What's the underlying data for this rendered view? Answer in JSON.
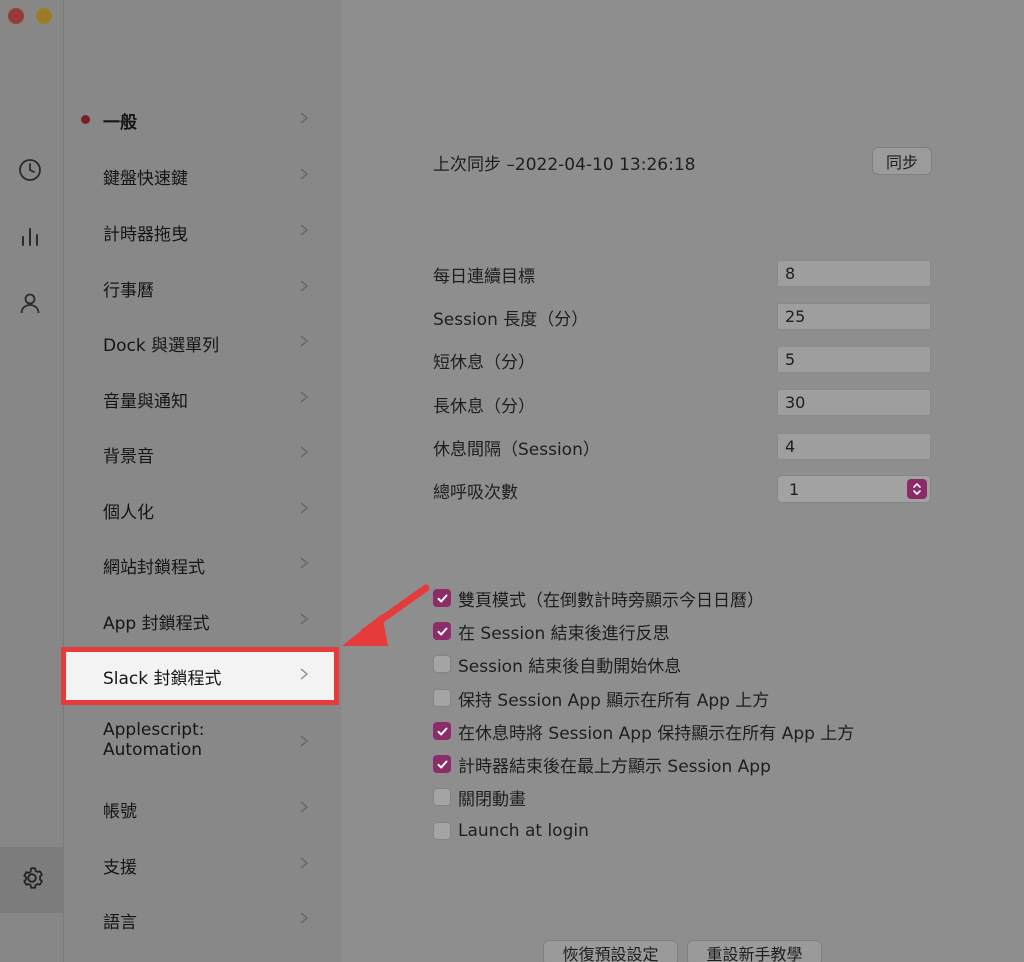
{
  "nav": {
    "items": [
      {
        "label": "一般"
      },
      {
        "label": "鍵盤快速鍵"
      },
      {
        "label": "計時器拖曳"
      },
      {
        "label": "行事曆"
      },
      {
        "label": "Dock 與選單列"
      },
      {
        "label": "音量與通知"
      },
      {
        "label": "背景音"
      },
      {
        "label": "個人化"
      },
      {
        "label": "網站封鎖程式"
      },
      {
        "label": "App 封鎖程式"
      },
      {
        "label": "Slack 封鎖程式"
      },
      {
        "label": "Applescript:",
        "label2": "Automation"
      },
      {
        "label": "帳號"
      },
      {
        "label": "支援"
      },
      {
        "label": "語言"
      }
    ]
  },
  "sync": {
    "text": "上次同步 –2022-04-10 13:26:18",
    "button": "同步"
  },
  "form": {
    "daily_goal": {
      "label": "每日連續目標",
      "value": "8"
    },
    "session_length": {
      "label": "Session 長度（分）",
      "value": "25"
    },
    "short_break": {
      "label": "短休息（分）",
      "value": "5"
    },
    "long_break": {
      "label": "長休息（分）",
      "value": "30"
    },
    "break_interval": {
      "label": "休息間隔（Session）",
      "value": "4"
    },
    "breaths": {
      "label": "總呼吸次數",
      "value": "1"
    }
  },
  "options": [
    {
      "label": "雙頁模式（在倒數計時旁顯示今日日曆）",
      "checked": true
    },
    {
      "label": "在 Session 結束後進行反思",
      "checked": true
    },
    {
      "label": "Session 結束後自動開始休息",
      "checked": false
    },
    {
      "label": "保持 Session App 顯示在所有 App  上方",
      "checked": false
    },
    {
      "label": "在休息時將 Session App 保持顯示在所有 App  上方",
      "checked": true
    },
    {
      "label": "計時器結束後在最上方顯示 Session App",
      "checked": true
    },
    {
      "label": "關閉動畫",
      "checked": false
    },
    {
      "label": "Launch at login",
      "checked": false
    }
  ],
  "footer": {
    "restore_defaults": "恢復預設設定",
    "reset_tutorial": "重設新手教學"
  },
  "colors": {
    "accent": "#8d2c6a",
    "highlight_border": "#e53b3b"
  }
}
